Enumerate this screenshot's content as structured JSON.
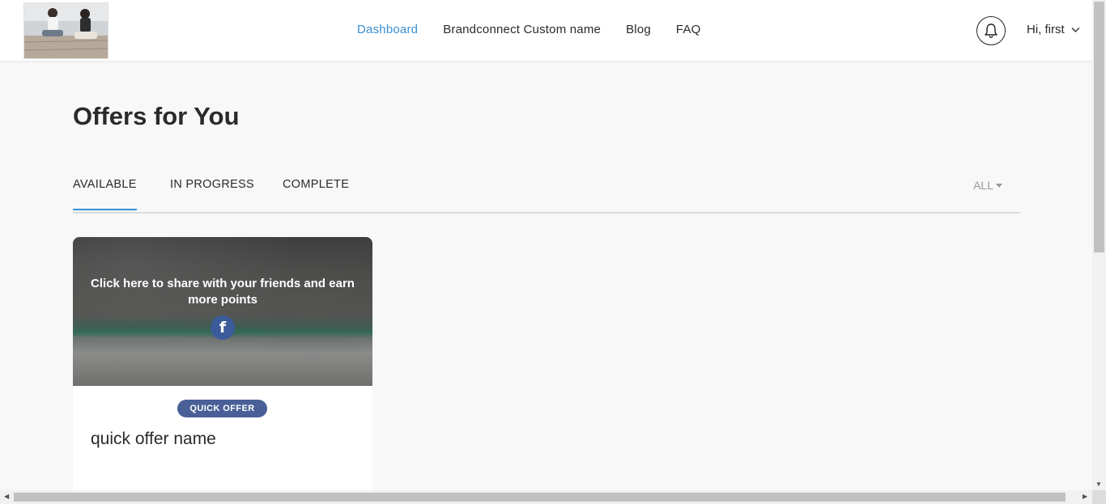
{
  "header": {
    "nav": [
      {
        "label": "Dashboard",
        "active": true
      },
      {
        "label": "Brandconnect Custom name",
        "active": false
      },
      {
        "label": "Blog",
        "active": false
      },
      {
        "label": "FAQ",
        "active": false
      }
    ],
    "user_greeting": "Hi, first",
    "accent_color": "#3a8fd0"
  },
  "main": {
    "title": "Offers for You",
    "tabs": [
      {
        "label": "AVAILABLE",
        "active": true
      },
      {
        "label": "IN PROGRESS",
        "active": false
      },
      {
        "label": "COMPLETE",
        "active": false
      }
    ],
    "filter": {
      "selected": "ALL"
    }
  },
  "offers": [
    {
      "share_text": "Click here to share with your friends and earn more points",
      "share_icon": "facebook-icon",
      "badge": "QUICK OFFER",
      "badge_color": "#4a5f97",
      "name": "quick offer name"
    }
  ]
}
